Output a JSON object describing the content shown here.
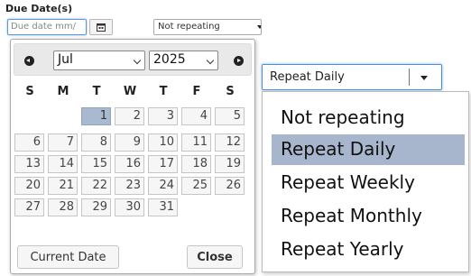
{
  "form": {
    "section_label": "Due Date(s)",
    "date_placeholder": "Due date mm/",
    "repeat_value_small": "Not repeating"
  },
  "datepicker": {
    "month": "Jul",
    "year": "2025",
    "weekdays": [
      "S",
      "M",
      "T",
      "W",
      "T",
      "F",
      "S"
    ],
    "days": [
      [
        "",
        "",
        "1",
        "2",
        "3",
        "4",
        "5"
      ],
      [
        "6",
        "7",
        "8",
        "9",
        "10",
        "11",
        "12"
      ],
      [
        "13",
        "14",
        "15",
        "16",
        "17",
        "18",
        "19"
      ],
      [
        "20",
        "21",
        "22",
        "23",
        "24",
        "25",
        "26"
      ],
      [
        "27",
        "28",
        "29",
        "30",
        "31",
        "",
        ""
      ]
    ],
    "active_day": "1",
    "current_date_label": "Current Date",
    "close_label": "Close"
  },
  "repeat": {
    "selected": "Repeat Daily",
    "options": [
      "Not repeating",
      "Repeat Daily",
      "Repeat Weekly",
      "Repeat Monthly",
      "Repeat Yearly"
    ]
  },
  "colors": {
    "focus_border": "#4a90d9",
    "active_day_bg": "#a9b9cf",
    "selected_option_bg": "#a7b6cc"
  },
  "icons": {
    "prev": "circle-triangle-left-icon",
    "next": "circle-triangle-right-icon",
    "calendar": "calendar-icon",
    "dropdown": "caret-down-icon"
  }
}
